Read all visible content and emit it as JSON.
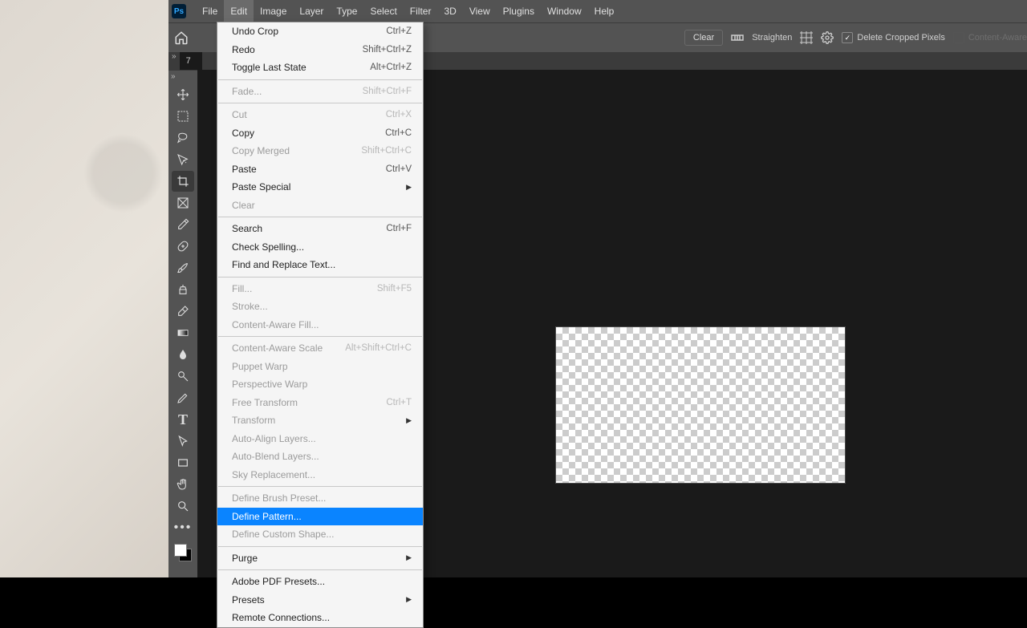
{
  "menubar": {
    "items": [
      "File",
      "Edit",
      "Image",
      "Layer",
      "Type",
      "Select",
      "Filter",
      "3D",
      "View",
      "Plugins",
      "Window",
      "Help"
    ],
    "active": "Edit",
    "logo": "Ps"
  },
  "optionsbar": {
    "clear": "Clear",
    "straighten": "Straighten",
    "delete_cropped": "Delete Cropped Pixels",
    "content_aware": "Content-Aware"
  },
  "document_tab": {
    "prefix": "7",
    "close": "×"
  },
  "toolbar": {
    "tools": [
      "move",
      "marquee",
      "lasso",
      "quick-select",
      "crop",
      "frame",
      "eyedropper",
      "healing",
      "brush",
      "clone",
      "eraser",
      "gradient",
      "blur",
      "dodge",
      "pen",
      "type",
      "path-select",
      "rectangle",
      "hand",
      "zoom",
      "more"
    ],
    "active": "crop"
  },
  "edit_menu": [
    {
      "t": "item",
      "label": "Undo Crop",
      "sc": "Ctrl+Z"
    },
    {
      "t": "item",
      "label": "Redo",
      "sc": "Shift+Ctrl+Z"
    },
    {
      "t": "item",
      "label": "Toggle Last State",
      "sc": "Alt+Ctrl+Z"
    },
    {
      "t": "sep"
    },
    {
      "t": "item",
      "label": "Fade...",
      "sc": "Shift+Ctrl+F",
      "dis": true
    },
    {
      "t": "sep"
    },
    {
      "t": "item",
      "label": "Cut",
      "sc": "Ctrl+X",
      "dis": true
    },
    {
      "t": "item",
      "label": "Copy",
      "sc": "Ctrl+C"
    },
    {
      "t": "item",
      "label": "Copy Merged",
      "sc": "Shift+Ctrl+C",
      "dis": true
    },
    {
      "t": "item",
      "label": "Paste",
      "sc": "Ctrl+V"
    },
    {
      "t": "item",
      "label": "Paste Special",
      "sub": true
    },
    {
      "t": "item",
      "label": "Clear",
      "dis": true
    },
    {
      "t": "sep"
    },
    {
      "t": "item",
      "label": "Search",
      "sc": "Ctrl+F"
    },
    {
      "t": "item",
      "label": "Check Spelling..."
    },
    {
      "t": "item",
      "label": "Find and Replace Text..."
    },
    {
      "t": "sep"
    },
    {
      "t": "item",
      "label": "Fill...",
      "sc": "Shift+F5",
      "dis": true
    },
    {
      "t": "item",
      "label": "Stroke...",
      "dis": true
    },
    {
      "t": "item",
      "label": "Content-Aware Fill...",
      "dis": true
    },
    {
      "t": "sep"
    },
    {
      "t": "item",
      "label": "Content-Aware Scale",
      "sc": "Alt+Shift+Ctrl+C",
      "dis": true
    },
    {
      "t": "item",
      "label": "Puppet Warp",
      "dis": true
    },
    {
      "t": "item",
      "label": "Perspective Warp",
      "dis": true
    },
    {
      "t": "item",
      "label": "Free Transform",
      "sc": "Ctrl+T",
      "dis": true
    },
    {
      "t": "item",
      "label": "Transform",
      "sub": true,
      "dis": true
    },
    {
      "t": "item",
      "label": "Auto-Align Layers...",
      "dis": true
    },
    {
      "t": "item",
      "label": "Auto-Blend Layers...",
      "dis": true
    },
    {
      "t": "item",
      "label": "Sky Replacement...",
      "dis": true
    },
    {
      "t": "sep"
    },
    {
      "t": "item",
      "label": "Define Brush Preset...",
      "dis": true
    },
    {
      "t": "item",
      "label": "Define Pattern...",
      "hl": true
    },
    {
      "t": "item",
      "label": "Define Custom Shape...",
      "dis": true
    },
    {
      "t": "sep"
    },
    {
      "t": "item",
      "label": "Purge",
      "sub": true
    },
    {
      "t": "sep"
    },
    {
      "t": "item",
      "label": "Adobe PDF Presets..."
    },
    {
      "t": "item",
      "label": "Presets",
      "sub": true
    },
    {
      "t": "item",
      "label": "Remote Connections..."
    }
  ],
  "colors": {
    "menubar": "#535353",
    "highlight": "#0a84ff"
  }
}
